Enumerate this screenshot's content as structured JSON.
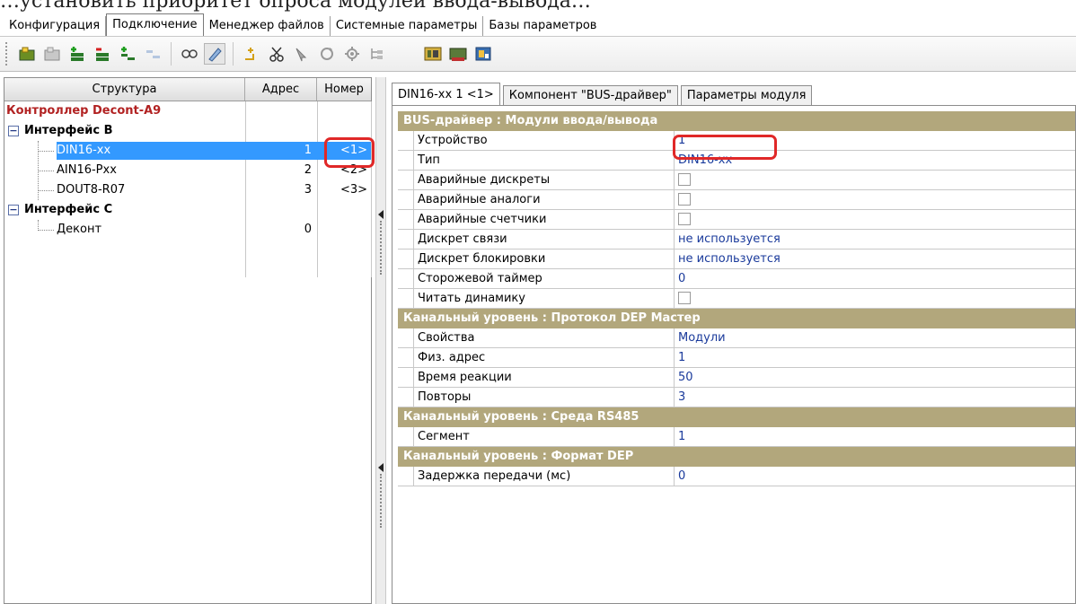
{
  "page_header_text": "…установить приоритет опроса модулей ввода-вывода…",
  "main_tabs": [
    {
      "label": "Конфигурация"
    },
    {
      "label": "Подключение",
      "active": true
    },
    {
      "label": "Менеджер файлов"
    },
    {
      "label": "Системные параметры"
    },
    {
      "label": "Базы параметров"
    }
  ],
  "toolbar_icons": [
    "add-module-icon",
    "remove-module-icon",
    "add-item-icon",
    "delete-item-icon",
    "add-child-icon",
    "collapse-icon",
    "link-icon",
    "edit-icon",
    "new-icon",
    "cut-icon",
    "copy-icon",
    "refresh-icon",
    "settings-icon",
    "tree-icon",
    "module-manager-icon",
    "network-icon",
    "device-icon"
  ],
  "tree": {
    "headers": {
      "structure": "Структура",
      "address": "Адрес",
      "number": "Номер"
    },
    "root": "Контроллер Decont-A9",
    "interfaces": [
      {
        "label": "Интерфейс B",
        "children": [
          {
            "name": "DIN16-xx",
            "address": "1",
            "number": "<1>",
            "selected": true
          },
          {
            "name": "AIN16-Pxx",
            "address": "2",
            "number": "<2>"
          },
          {
            "name": "DOUT8-R07",
            "address": "3",
            "number": "<3>"
          }
        ]
      },
      {
        "label": "Интерфейс C",
        "children": [
          {
            "name": "Деконт",
            "address": "0",
            "number": ""
          }
        ]
      }
    ]
  },
  "sub_tabs": [
    {
      "label": "DIN16-xx 1 <1>",
      "active": true
    },
    {
      "label": "Компонент \"BUS-драйвер\""
    },
    {
      "label": "Параметры модуля"
    }
  ],
  "properties": {
    "sections": [
      {
        "title": "BUS-драйвер : Модули ввода/вывода",
        "rows": [
          {
            "name": "Устройство",
            "value": "1",
            "highlight": true
          },
          {
            "name": "Тип",
            "value": "DIN16-xx"
          },
          {
            "name": "Аварийные дискреты",
            "checkbox": true,
            "checked": false
          },
          {
            "name": "Аварийные аналоги",
            "checkbox": true,
            "checked": false
          },
          {
            "name": "Аварийные счетчики",
            "checkbox": true,
            "checked": false
          },
          {
            "name": "Дискрет связи",
            "value": "не используется"
          },
          {
            "name": "Дискрет блокировки",
            "value": "не используется"
          },
          {
            "name": "Сторожевой таймер",
            "value": "0"
          },
          {
            "name": "Читать динамику",
            "checkbox": true,
            "checked": false
          }
        ]
      },
      {
        "title": "Канальный уровень : Протокол DEP Мастер",
        "rows": [
          {
            "name": "Свойства",
            "value": "Модули"
          },
          {
            "name": "Физ. адрес",
            "value": "1"
          },
          {
            "name": "Время реакции",
            "value": "50"
          },
          {
            "name": "Повторы",
            "value": "3"
          }
        ]
      },
      {
        "title": "Канальный уровень : Среда RS485",
        "rows": [
          {
            "name": "Сегмент",
            "value": "1"
          }
        ]
      },
      {
        "title": "Канальный уровень : Формат DEP",
        "rows": [
          {
            "name": "Задержка передачи (мс)",
            "value": "0"
          }
        ]
      }
    ]
  },
  "colors": {
    "section_header": "#b2a77c",
    "selection": "#3399ff",
    "root_label": "#b22222",
    "value_text": "#1a3a9b",
    "highlight_box": "#e02828"
  }
}
